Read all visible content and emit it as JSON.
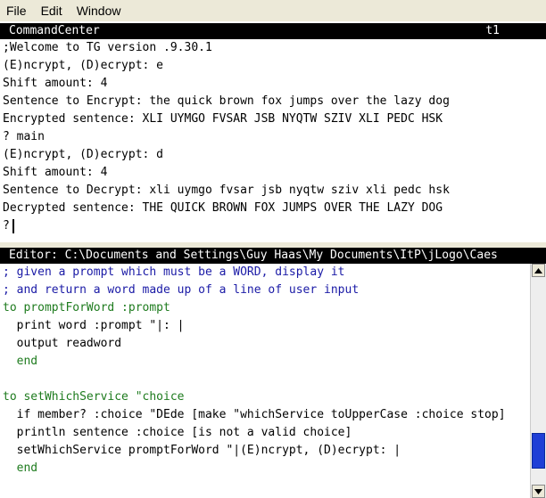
{
  "menubar": {
    "items": [
      "File",
      "Edit",
      "Window"
    ]
  },
  "command_center": {
    "title": "CommandCenter",
    "tag": "t1",
    "lines": [
      ";Welcome to TG version .9.30.1",
      "(E)ncrypt, (D)ecrypt: e",
      "Shift amount: 4",
      "Sentence to Encrypt: the quick brown fox jumps over the lazy dog",
      "Encrypted sentence: XLI UYMGO FVSAR JSB NYQTW SZIV XLI PEDC HSK",
      "? main",
      "(E)ncrypt, (D)ecrypt: d",
      "Shift amount: 4",
      "Sentence to Decrypt: xli uymgo fvsar jsb nyqtw sziv xli pedc hsk",
      "Decrypted sentence: THE QUICK BROWN FOX JUMPS OVER THE LAZY DOG"
    ],
    "prompt": "?"
  },
  "editor": {
    "title": "Editor: C:\\Documents and Settings\\Guy Haas\\My Documents\\ItP\\jLogo\\Caes",
    "lines": [
      {
        "text": "; given a prompt which must be a WORD, display it",
        "kind": "comment"
      },
      {
        "text": "; and return a word made up of a line of user input",
        "kind": "comment"
      },
      {
        "text": "to promptForWord :prompt",
        "kind": "def"
      },
      {
        "text": "  print word :prompt \"|: |",
        "kind": "code"
      },
      {
        "text": "  output readword",
        "kind": "code"
      },
      {
        "text": "  end",
        "kind": "def"
      },
      {
        "text": "",
        "kind": "code"
      },
      {
        "text": "to setWhichService \"choice",
        "kind": "def"
      },
      {
        "text": "  if member? :choice \"DEde [make \"whichService toUpperCase :choice stop]",
        "kind": "code"
      },
      {
        "text": "  println sentence :choice [is not a valid choice]",
        "kind": "code"
      },
      {
        "text": "  setWhichService promptForWord \"|(E)ncrypt, (D)ecrypt: |",
        "kind": "code"
      },
      {
        "text": "  end",
        "kind": "def"
      }
    ]
  },
  "colors": {
    "comment": "#1a1aa6",
    "definition": "#1e7b1e",
    "scroll_thumb": "#1f3fd6"
  }
}
